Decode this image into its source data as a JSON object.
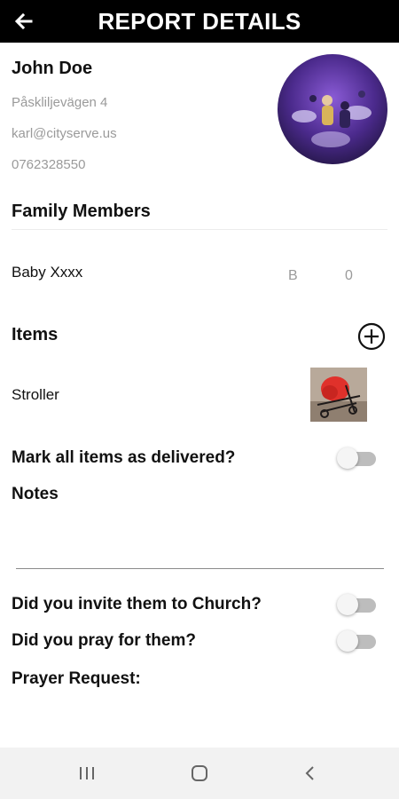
{
  "header": {
    "title": "REPORT DETAILS",
    "back_icon": "arrow-left-icon"
  },
  "profile": {
    "name": "John Doe",
    "address": "Påskliljevägen 4",
    "email": "karl@cityserve.us",
    "phone": "0762328550"
  },
  "family": {
    "title": "Family Members",
    "members": [
      {
        "name": "Baby Xxxx",
        "gender": "B",
        "age": "0"
      }
    ]
  },
  "items": {
    "title": "Items",
    "add_icon": "plus-circle-icon",
    "list": [
      {
        "name": "Stroller"
      }
    ]
  },
  "delivery": {
    "label": "Mark all items as delivered?",
    "checked": false
  },
  "notes": {
    "label": "Notes",
    "value": ""
  },
  "church": {
    "invite_label": "Did you invite them to Church?",
    "invite_checked": false,
    "pray_label": "Did you pray for them?",
    "pray_checked": false
  },
  "prayer": {
    "label": "Prayer Request:"
  },
  "navbar": {
    "recents_icon": "recents-icon",
    "home_icon": "home-icon",
    "back_icon": "back-chevron-icon"
  },
  "colors": {
    "appbar": "#000000",
    "toggle_track": "#bdbdbd",
    "muted_text": "#9a9a9a",
    "navbar": "#f2f2f2"
  }
}
